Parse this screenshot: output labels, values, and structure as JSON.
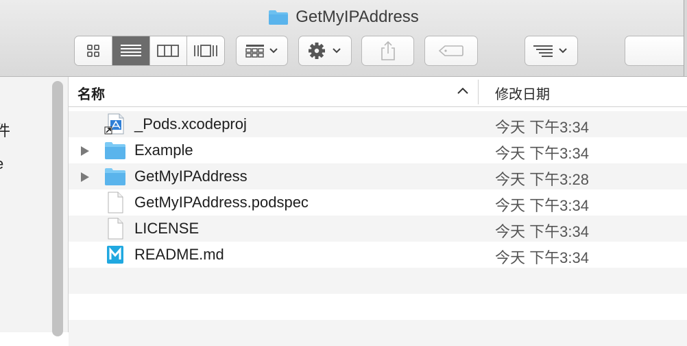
{
  "window": {
    "title": "GetMyIPAddress"
  },
  "toolbar": {
    "view_modes": [
      "icon-view",
      "list-view",
      "column-view",
      "cover-flow-view"
    ],
    "active_view": "list-view",
    "buttons": [
      "arrange",
      "action",
      "share",
      "edit-tags",
      "sort-options"
    ]
  },
  "sidebar": {
    "items": [
      {
        "label": "件"
      },
      {
        "label": "e"
      }
    ]
  },
  "columns": {
    "name": "名称",
    "date": "修改日期",
    "sort": "ascending"
  },
  "files": [
    {
      "name": "_Pods.xcodeproj",
      "date": "今天 下午3:34",
      "kind": "xcodeproj-icon",
      "expandable": false
    },
    {
      "name": "Example",
      "date": "今天 下午3:34",
      "kind": "folder-icon",
      "expandable": true
    },
    {
      "name": "GetMyIPAddress",
      "date": "今天 下午3:28",
      "kind": "folder-icon",
      "expandable": true
    },
    {
      "name": "GetMyIPAddress.podspec",
      "date": "今天 下午3:34",
      "kind": "document-icon",
      "expandable": false
    },
    {
      "name": "LICENSE",
      "date": "今天 下午3:34",
      "kind": "document-icon",
      "expandable": false
    },
    {
      "name": "README.md",
      "date": "今天 下午3:34",
      "kind": "markdown-icon",
      "expandable": false
    }
  ],
  "colors": {
    "folder": "#5ab4ec",
    "active_segment": "#6c6c6c",
    "stripe": "#f4f4f4"
  }
}
